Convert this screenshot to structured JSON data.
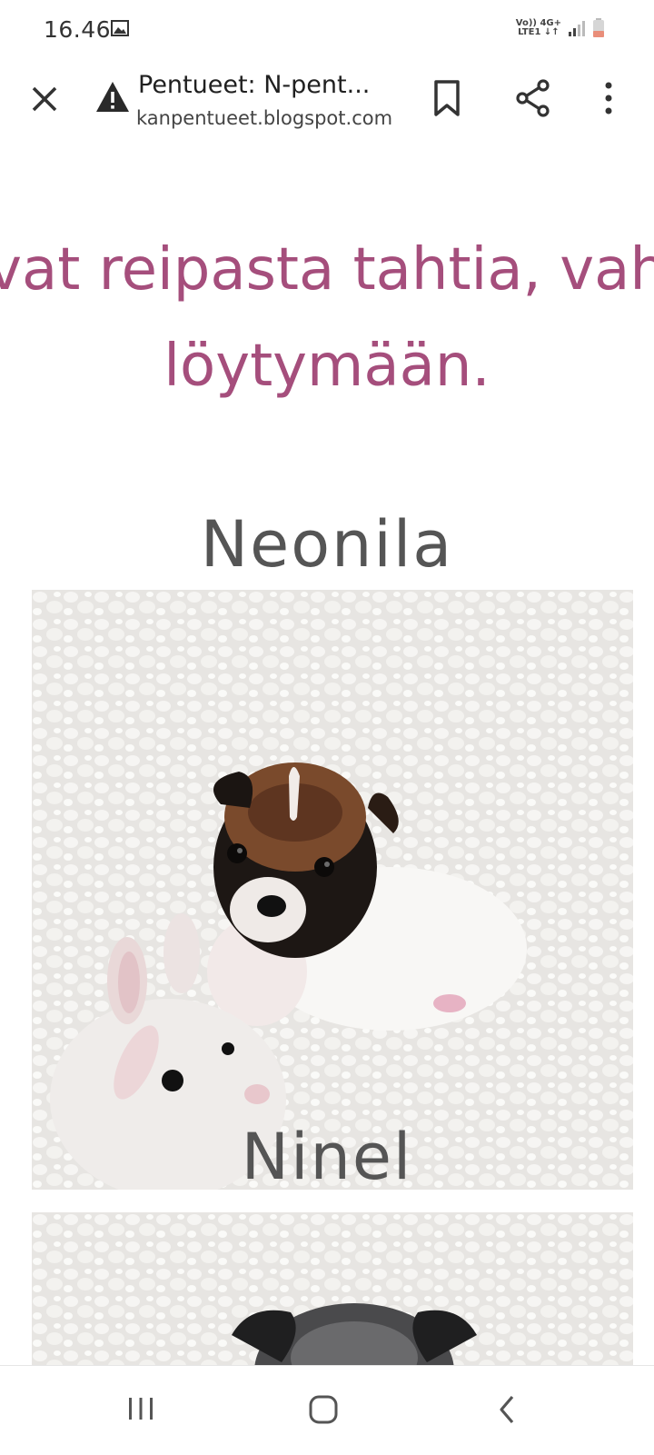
{
  "status_bar": {
    "time": "16.46",
    "network_top": "Vo)) 4G+",
    "network_bottom": "LTE1 ↓↑"
  },
  "browser": {
    "page_title": "Pentueet: N-pent...",
    "url": "kanpentueet.blogspot.com",
    "icons": [
      "close-icon",
      "warning-icon",
      "bookmark-icon",
      "share-icon",
      "more-icon"
    ]
  },
  "article": {
    "headline_line1": "vat reipasta tahtia, vah",
    "headline_line2": "löytymään.",
    "accent_color": "#a54e7c",
    "puppies": [
      {
        "name": "Neonila"
      },
      {
        "name": "Ninel"
      }
    ]
  },
  "nav_bar": {
    "buttons": [
      "recents-button",
      "home-button",
      "back-button"
    ]
  }
}
